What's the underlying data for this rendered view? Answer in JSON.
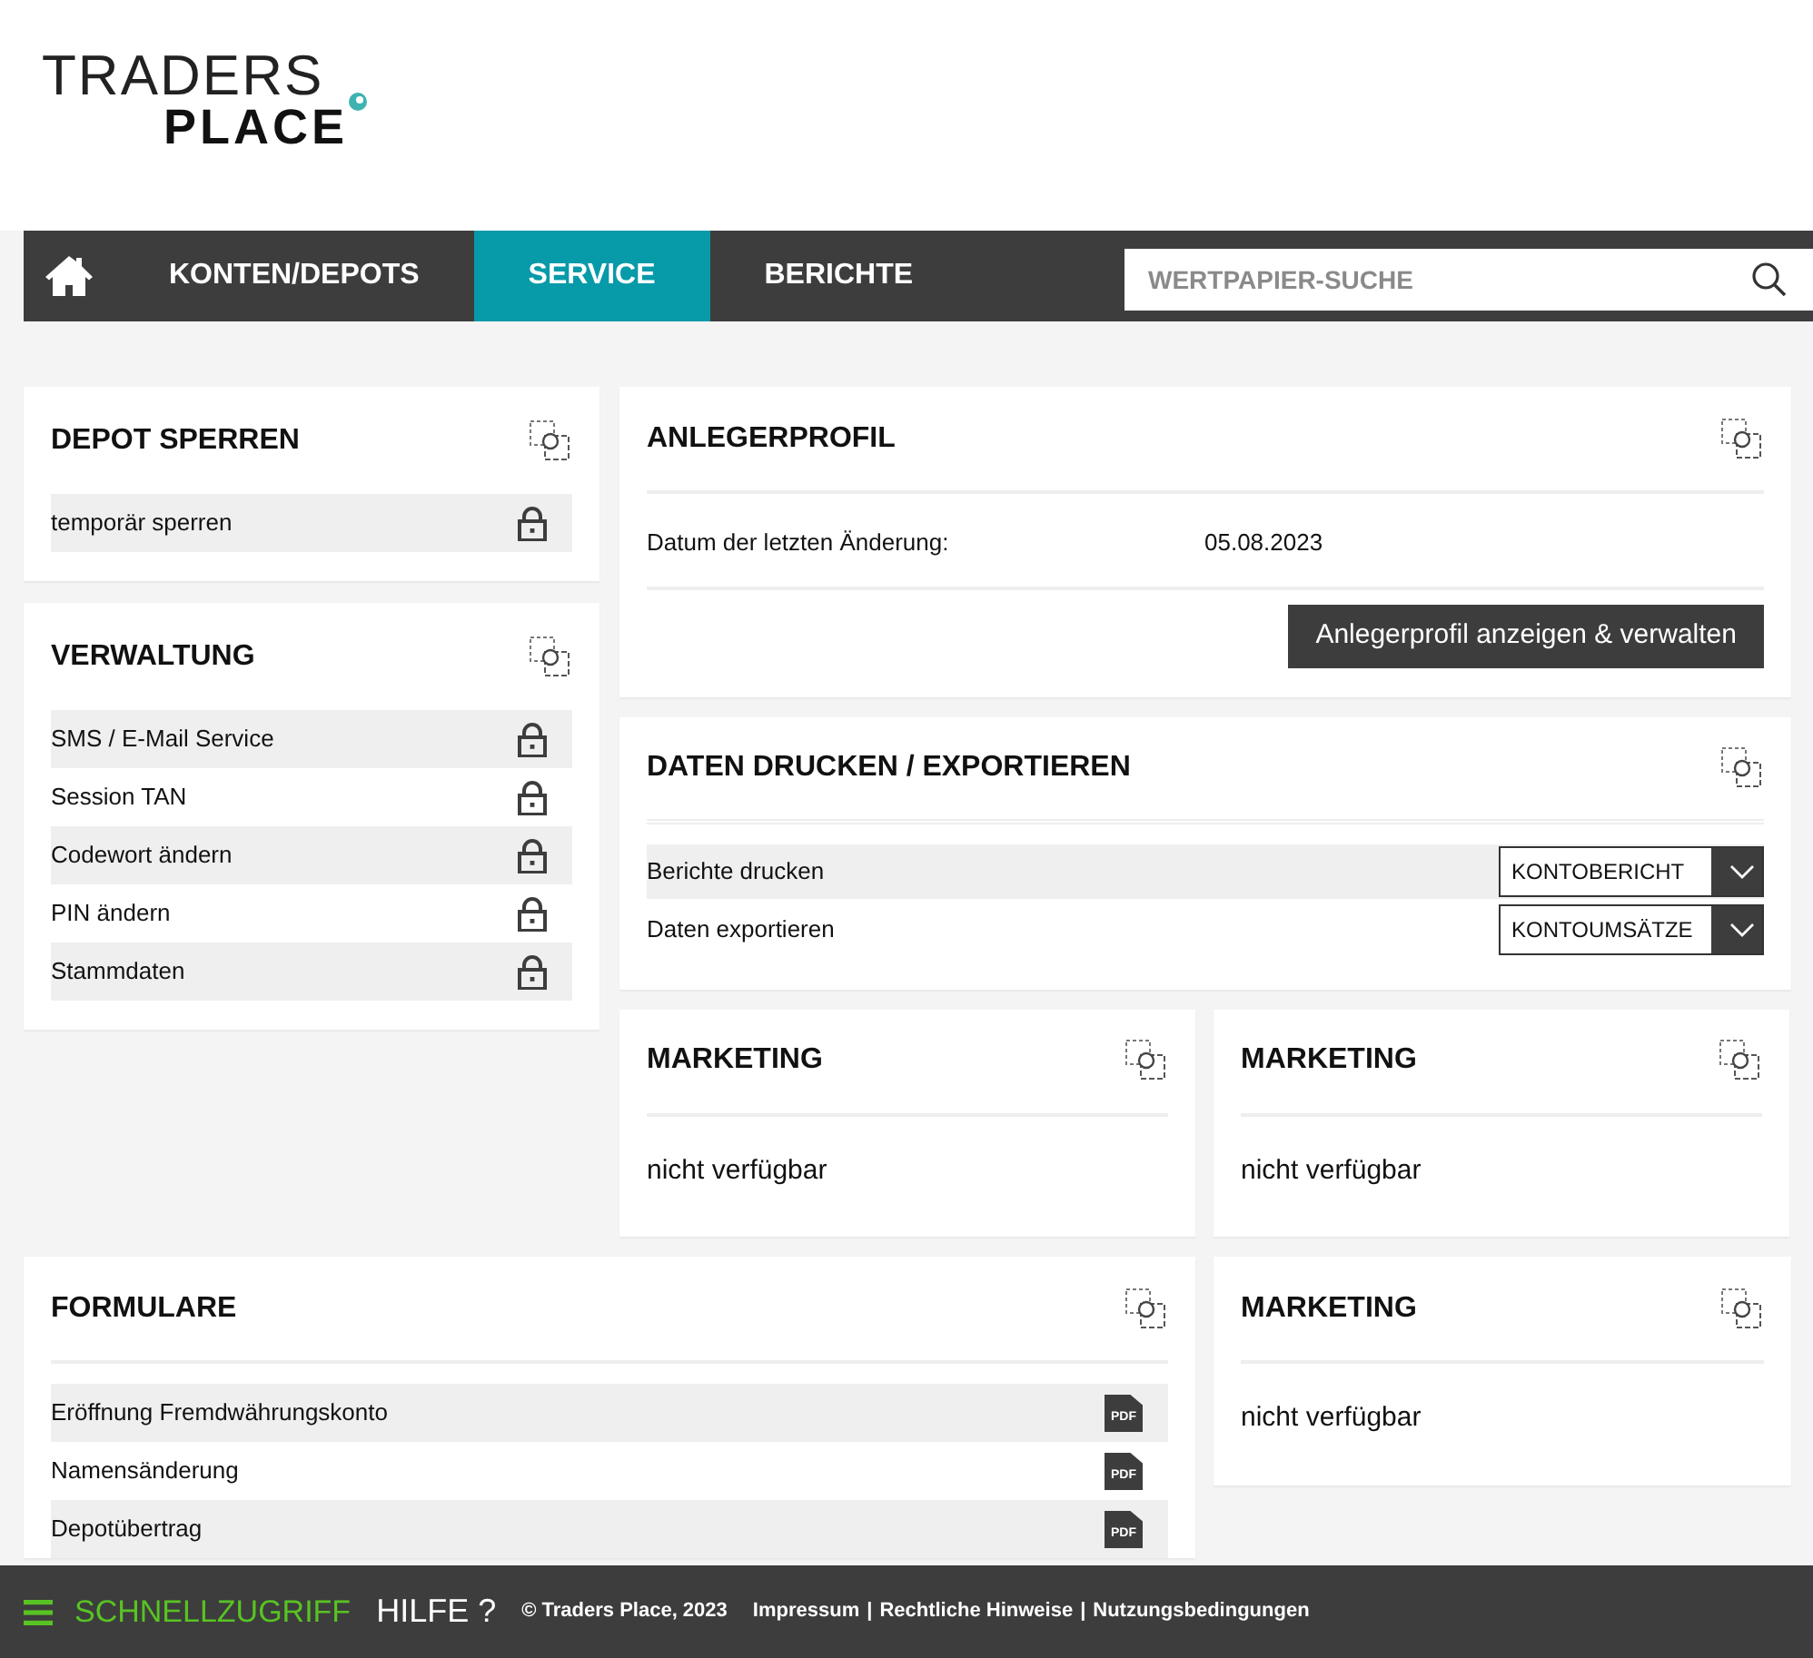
{
  "logo": {
    "top": "TRADERS",
    "bottom": "PLACE"
  },
  "nav": {
    "items": [
      {
        "kind": "home",
        "selected": false
      },
      {
        "kind": "text",
        "label": "KONTEN/DEPOTS",
        "selected": false
      },
      {
        "kind": "text",
        "label": "SERVICE",
        "selected": true
      },
      {
        "kind": "text",
        "label": "BERICHTE",
        "selected": false
      }
    ],
    "search": {
      "placeholder": "WERTPAPIER-SUCHE"
    }
  },
  "panels": [
    {
      "kind": "links",
      "title": "DEPOT SPERREN",
      "items": [
        {
          "label": "temporär sperren"
        }
      ]
    },
    {
      "kind": "links",
      "title": "VERWALTUNG",
      "items": [
        {
          "label": "SMS / E-Mail Service"
        },
        {
          "label": "Session TAN"
        },
        {
          "label": "Codewort ändern"
        },
        {
          "label": "PIN ändern"
        },
        {
          "label": "Stammdaten"
        }
      ]
    },
    {
      "kind": "profile",
      "title": "ANLEGERPROFIL",
      "fields": [
        {
          "label": "Datum der letzten Änderung:",
          "value": "05.08.2023"
        }
      ],
      "button": "Anlegerprofil anzeigen & verwalten"
    },
    {
      "kind": "export",
      "title": "DATEN DRUCKEN / EXPORTIEREN",
      "rows": [
        {
          "label": "Berichte drucken",
          "value": "KONTOBERICHT"
        },
        {
          "label": "Daten exportieren",
          "value": "KONTOUMSÄTZE"
        }
      ]
    },
    {
      "kind": "text",
      "title": "MARKETING",
      "text": "nicht verfügbar"
    },
    {
      "kind": "text",
      "title": "MARKETING",
      "text": "nicht verfügbar"
    },
    {
      "kind": "forms",
      "title": "FORMULARE",
      "items": [
        {
          "label": "Eröffnung Fremdwährungskonto",
          "file_type": "PDF"
        },
        {
          "label": "Namensänderung",
          "file_type": "PDF"
        },
        {
          "label": "Depotübertrag",
          "file_type": "PDF"
        }
      ]
    },
    {
      "kind": "text",
      "title": "MARKETING",
      "text": "nicht verfügbar"
    }
  ],
  "footer": {
    "quick_access": "SCHNELLZUGRIFF",
    "help": "HILFE ?",
    "copyright": "© Traders Place, 2023",
    "links": [
      "Impressum",
      "Rechtliche Hinweise",
      "Nutzungsbedingungen"
    ],
    "separator": "|"
  }
}
